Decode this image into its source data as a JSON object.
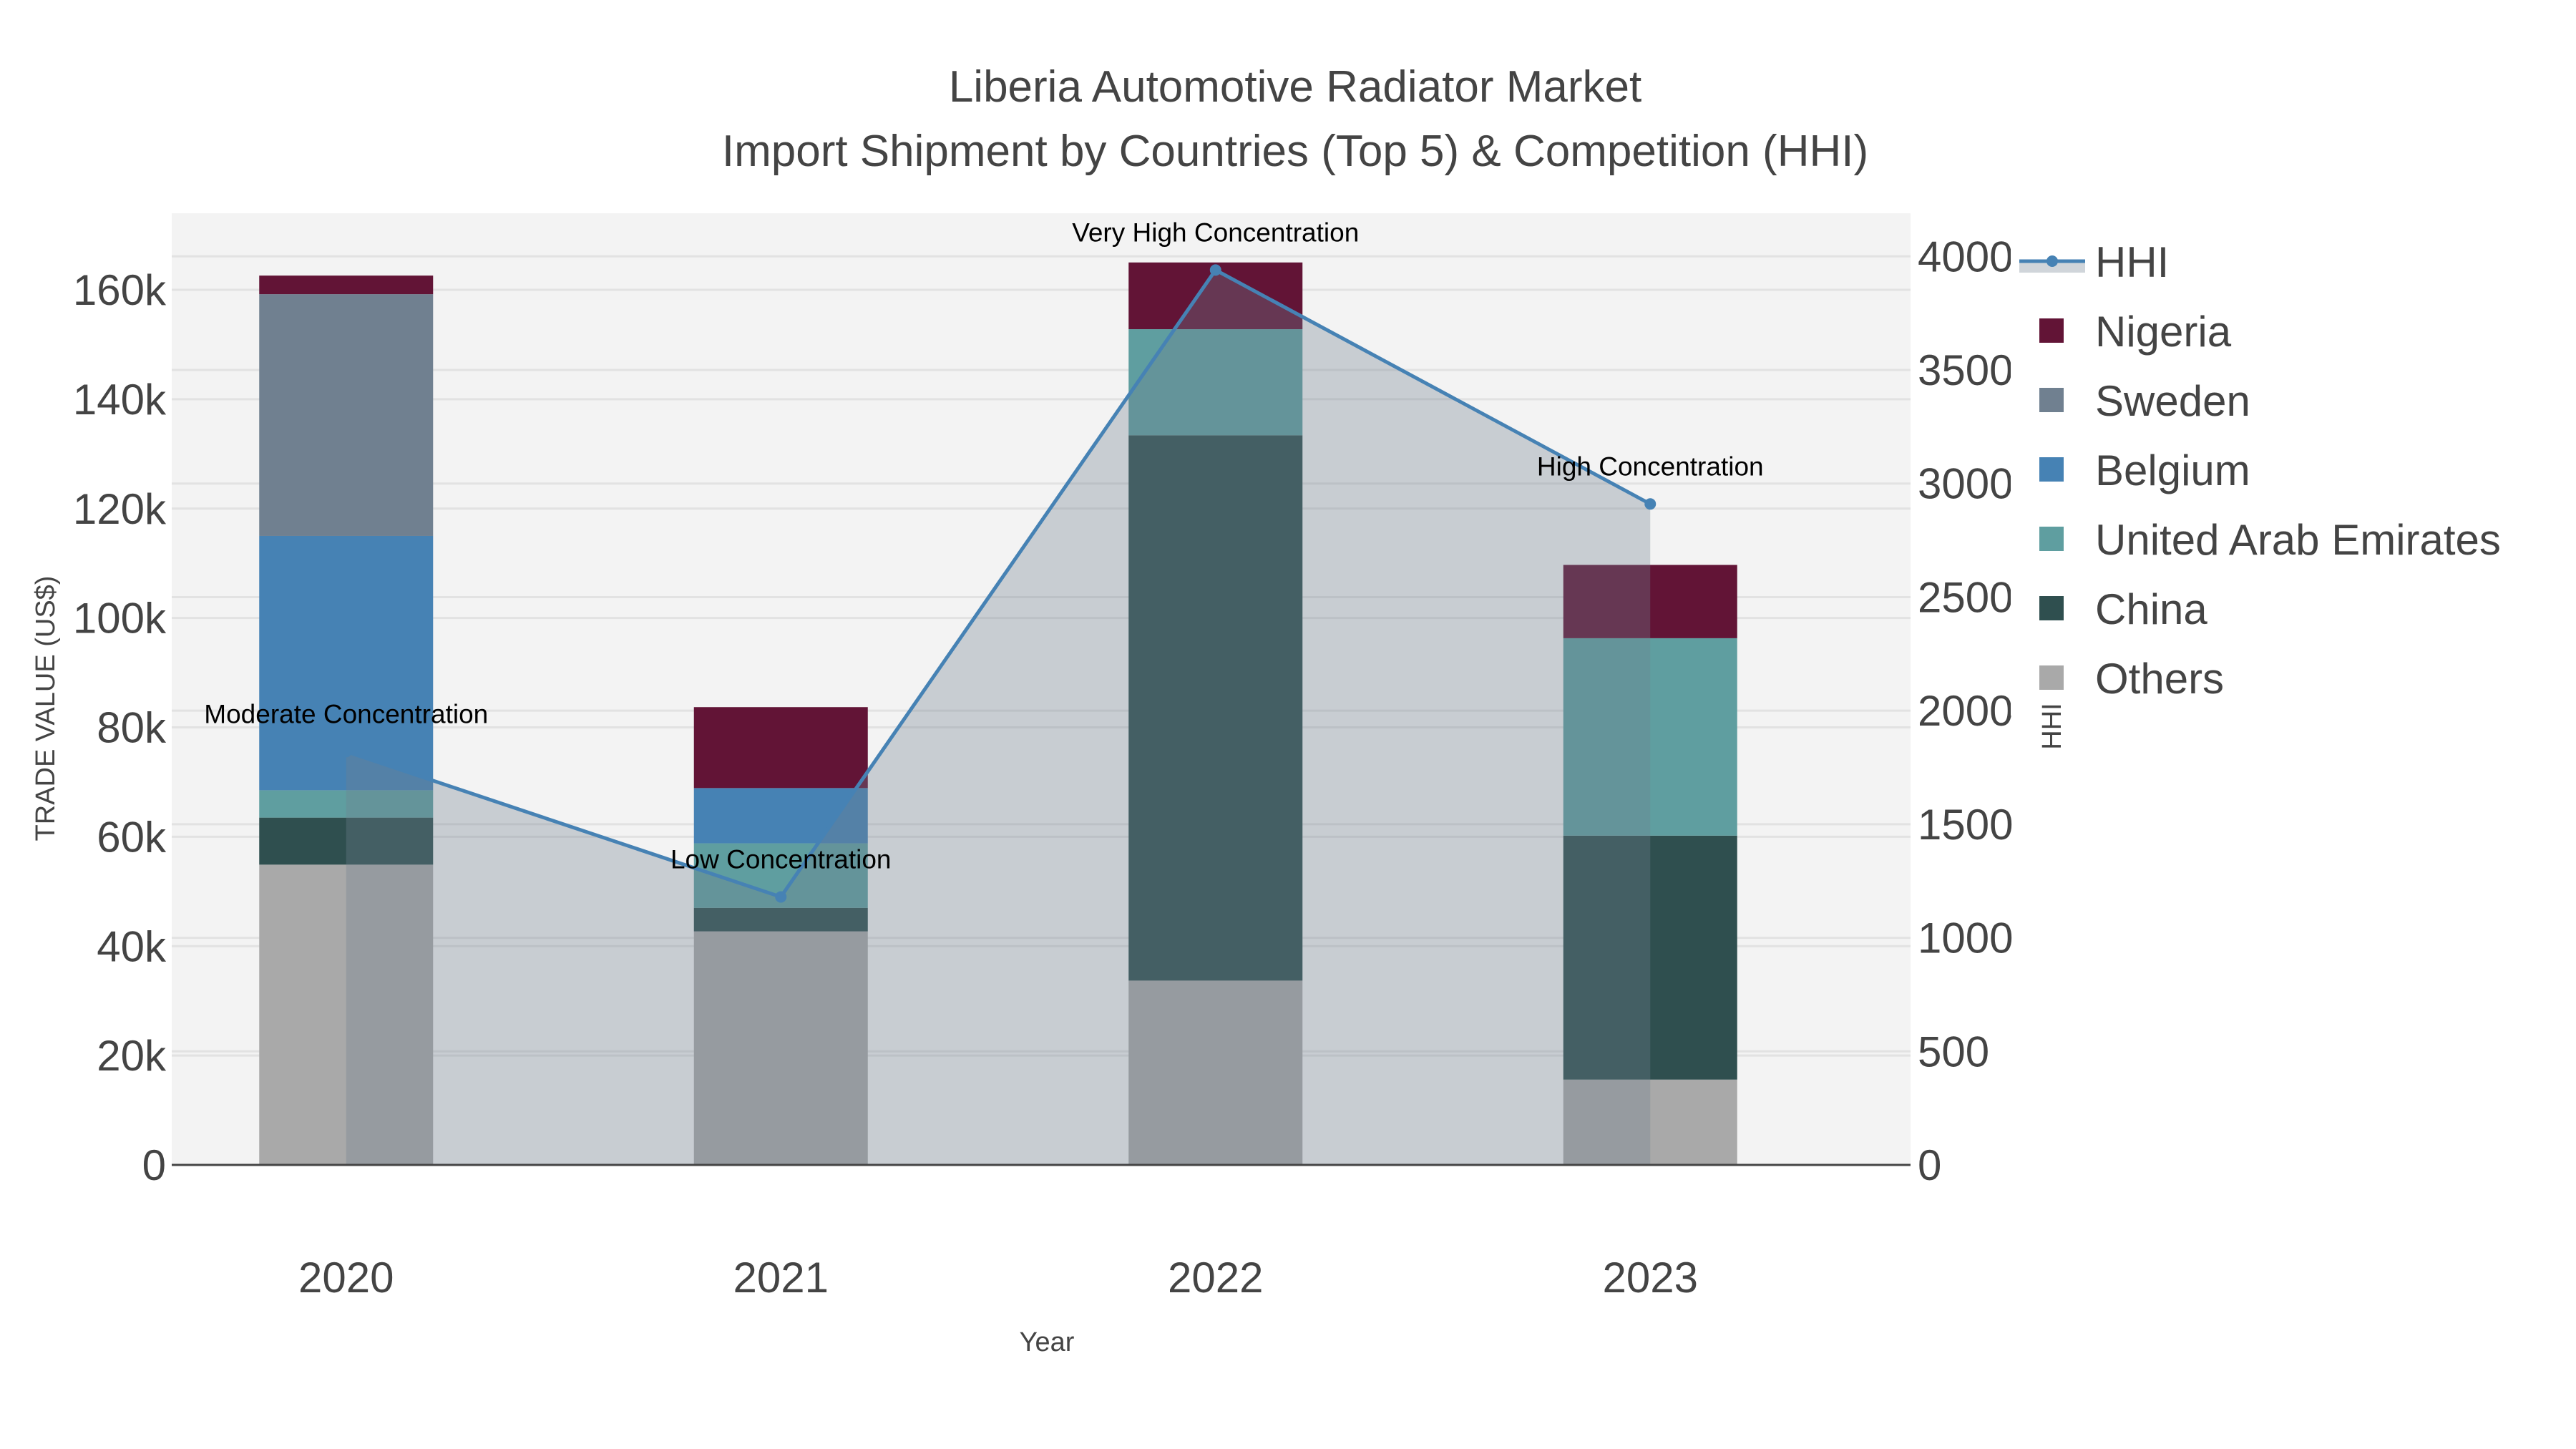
{
  "chart_data": {
    "type": "bar",
    "barmode": "stack",
    "title": "Liberia Automotive Radiator Market",
    "subtitle": "Import Shipment by Countries (Top 5) & Competition (HHI)",
    "xlabel": "Year",
    "ylabel": "TRADE VALUE (US$)",
    "y2label": "HHI",
    "categories": [
      "2020",
      "2021",
      "2022",
      "2023"
    ],
    "ylim": [
      0,
      174000
    ],
    "y2lim": [
      0,
      4190
    ],
    "yticks": [
      0,
      20000,
      40000,
      60000,
      80000,
      100000,
      120000,
      140000,
      160000
    ],
    "ytick_labels": [
      "0",
      "20k",
      "40k",
      "60k",
      "80k",
      "100k",
      "120k",
      "140k",
      "160k"
    ],
    "y2ticks": [
      0,
      500,
      1000,
      1500,
      2000,
      2500,
      3000,
      3500,
      4000
    ],
    "y2tick_labels": [
      "0",
      "500",
      "1000",
      "1500",
      "2000",
      "2500",
      "3000",
      "3500",
      "4000"
    ],
    "grid": true,
    "legend_position": "right",
    "series": [
      {
        "name": "Others",
        "color": "#a9a9a9",
        "values": [
          54900,
          42700,
          33700,
          15600
        ]
      },
      {
        "name": "China",
        "color": "#2f4f4f",
        "values": [
          8600,
          4300,
          99700,
          44600
        ]
      },
      {
        "name": "United Arab Emirates",
        "color": "#5f9ea0",
        "values": [
          5000,
          11800,
          19400,
          36100
        ]
      },
      {
        "name": "Belgium",
        "color": "#4682b4",
        "values": [
          46500,
          10100,
          0,
          0
        ]
      },
      {
        "name": "Sweden",
        "color": "#708090",
        "values": [
          44200,
          0,
          0,
          0
        ]
      },
      {
        "name": "Nigeria",
        "color": "#621436",
        "values": [
          3400,
          14800,
          12200,
          13400
        ]
      }
    ],
    "hhi": {
      "name": "HHI",
      "color": "#4682b4",
      "values": [
        1820,
        1180,
        3940,
        2910
      ],
      "annotations": [
        "Moderate Concentration",
        "Low Concentration",
        "Very High Concentration",
        "High Concentration"
      ]
    },
    "legend_order": [
      "HHI",
      "Nigeria",
      "Sweden",
      "Belgium",
      "United Arab Emirates",
      "China",
      "Others"
    ]
  }
}
